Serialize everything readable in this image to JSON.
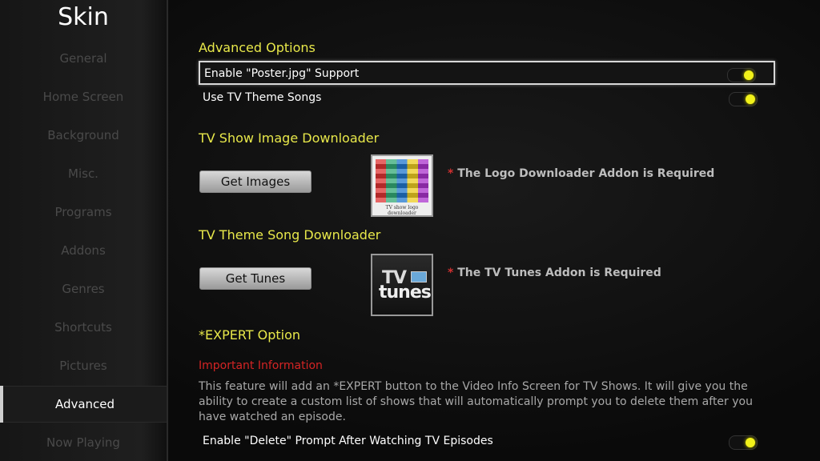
{
  "sidebar": {
    "title": "Skin",
    "items": [
      {
        "label": "General"
      },
      {
        "label": "Home Screen"
      },
      {
        "label": "Background"
      },
      {
        "label": "Misc."
      },
      {
        "label": "Programs"
      },
      {
        "label": "Addons"
      },
      {
        "label": "Genres"
      },
      {
        "label": "Shortcuts"
      },
      {
        "label": "Pictures"
      },
      {
        "label": "Advanced"
      },
      {
        "label": "Now Playing"
      }
    ],
    "active": "Advanced"
  },
  "advanced_options": {
    "title": "Advanced Options",
    "options": [
      {
        "label": "Enable \"Poster.jpg\" Support",
        "enabled": true
      },
      {
        "label": "Use TV Theme Songs",
        "enabled": true
      }
    ]
  },
  "image_downloader": {
    "title": "TV Show Image Downloader",
    "button": "Get Images",
    "thumb_caption": "TV show logo downloader",
    "note_star": "*",
    "note": "The Logo Downloader Addon is Required"
  },
  "theme_downloader": {
    "title": "TV Theme Song Downloader",
    "button": "Get Tunes",
    "thumb_tv": "TV",
    "thumb_tunes": "tunes",
    "note_star": "*",
    "note": "The TV Tunes Addon is Required"
  },
  "expert": {
    "title": "*EXPERT Option",
    "important_title": "Important Information",
    "description": "This feature will add an *EXPERT button to the Video Info Screen for TV Shows.  It will give you the ability to create a custom list of shows that will automatically prompt you to delete them after you have watched an episode.",
    "option": {
      "label": "Enable \"Delete\" Prompt After Watching TV Episodes",
      "enabled": true
    }
  },
  "colors": {
    "accent_yellow": "#e8e84a",
    "toggle_on": "#f2f21a",
    "important_red": "#d42424"
  }
}
